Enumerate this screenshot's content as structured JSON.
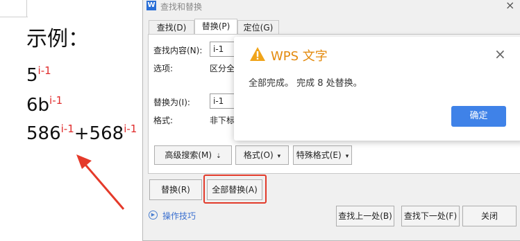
{
  "document": {
    "heading": "示例：",
    "lines": [
      {
        "base": "5",
        "sup": "i-1"
      },
      {
        "base": "6b",
        "sup": "i-1"
      },
      {
        "base1": "586",
        "sup1": "i-1",
        "plus": "+568",
        "sup2": "i-1"
      }
    ]
  },
  "dialog": {
    "title": "查找和替换",
    "app_icon": "W",
    "close": "×",
    "tabs": [
      "查找(D)",
      "替换(P)",
      "定位(G)"
    ],
    "active_tab": "替换(P)",
    "find_label": "查找内容(N):",
    "find_value": "i-1",
    "options_label": "选项:",
    "options_value": "区分全/",
    "replace_label": "替换为(I):",
    "replace_value": "i-1",
    "format_label": "格式:",
    "format_value": "非下标,",
    "advanced_search": "高级搜索(M)",
    "advanced_caret": "⇣",
    "format_btn": "格式(O)",
    "special_format_btn": "特殊格式(E)",
    "caret": "▾",
    "replace_btn": "替换(R)",
    "replace_all_btn": "全部替换(A)",
    "tips": "操作技巧",
    "find_prev": "查找上一处(B)",
    "find_next": "查找下一处(F)",
    "close_btn": "关闭"
  },
  "message": {
    "title": "WPS 文字",
    "text": "全部完成。 完成 8 处替换。",
    "ok": "确定",
    "close": "×"
  },
  "colors": {
    "sup_red": "#e02b2b",
    "highlight_red": "#e23a2a",
    "wps_orange": "#e38a0d",
    "ok_blue": "#3f82e8",
    "link_blue": "#3a6fcf"
  }
}
